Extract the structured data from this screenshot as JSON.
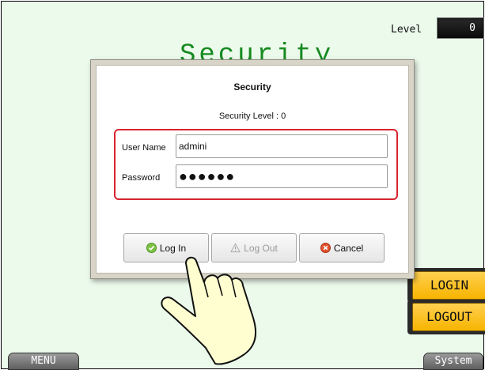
{
  "header": {
    "level_label": "Level",
    "level_value": "0",
    "background_title": "Security"
  },
  "side_buttons": {
    "login": "LOGIN",
    "logout": "LOGOUT"
  },
  "bottom": {
    "menu": "MENU",
    "system": "System"
  },
  "dialog": {
    "title": "Security",
    "security_level_text": "Security Level : 0",
    "username_label": "User Name",
    "username_value": "admini",
    "password_label": "Password",
    "password_value": "●●●●●●",
    "buttons": {
      "login": "Log In",
      "logout": "Log Out",
      "cancel": "Cancel"
    }
  },
  "colors": {
    "screen_bg": "#ecfaec",
    "title_green": "#168a20",
    "side_button_yellow": "#f7b400",
    "highlight_red": "#d9232e",
    "login_icon_green": "#7cc242",
    "cancel_icon_red": "#e0502a"
  },
  "icons": {
    "login": "green-check-circle-icon",
    "logout": "warning-triangle-icon",
    "cancel": "red-x-circle-icon",
    "hand": "pointing-hand-icon"
  }
}
